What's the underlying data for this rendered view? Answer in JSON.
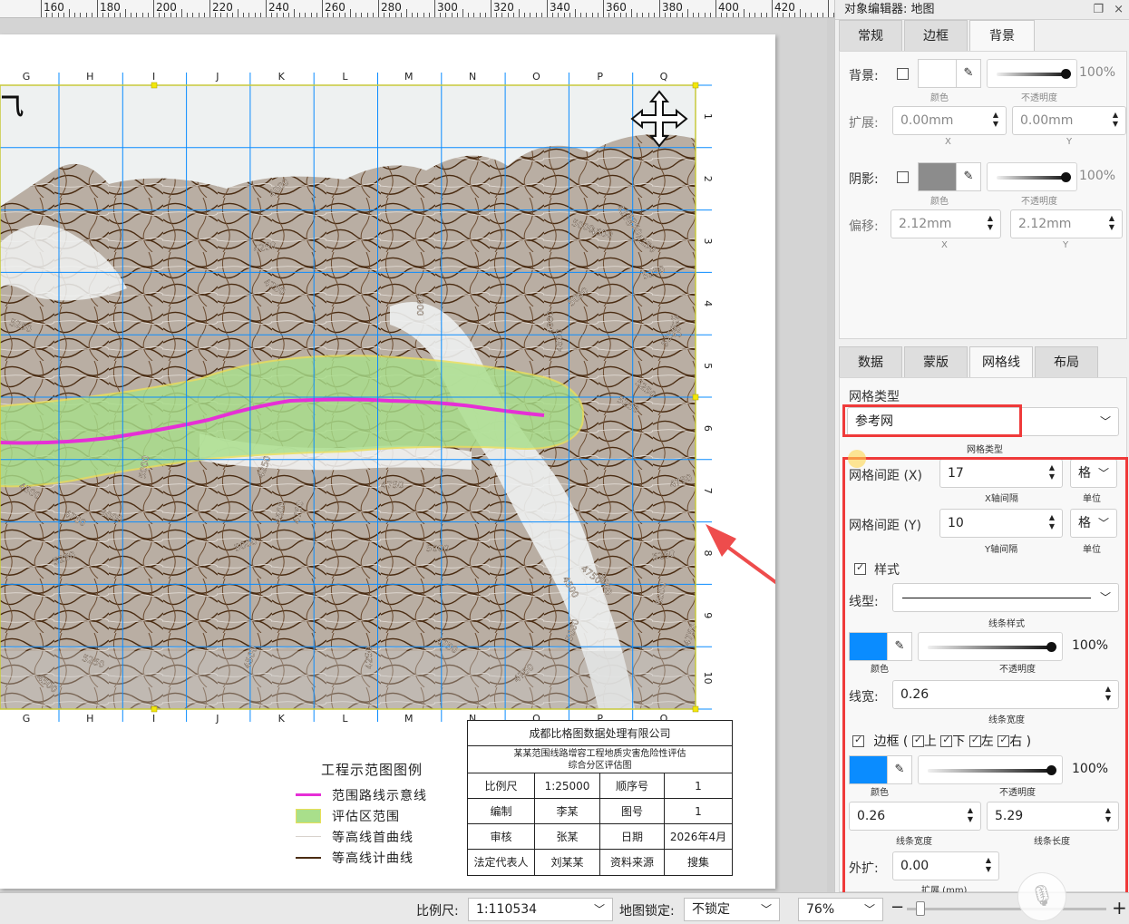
{
  "ruler": {
    "labels": [
      "160",
      "180",
      "200",
      "220",
      "240",
      "260",
      "280",
      "300",
      "320",
      "340",
      "360",
      "380",
      "400",
      "420"
    ]
  },
  "map": {
    "columns": [
      "G",
      "H",
      "I",
      "J",
      "K",
      "L",
      "M",
      "N",
      "O",
      "P",
      "Q"
    ],
    "rows": [
      "1",
      "2",
      "3",
      "4",
      "5",
      "6",
      "7",
      "8",
      "9",
      "10"
    ],
    "corner_text": "⺄",
    "contour_labels": [
      "4000",
      "4250",
      "4750",
      "5000",
      "4500",
      "5250",
      "4000",
      "4750",
      "5000",
      "5250",
      "4500",
      "4250",
      "4750",
      "5000",
      "5250",
      "5000",
      "4750",
      "4500",
      "5000",
      "5250",
      "5500",
      "4250",
      "4500",
      "5000",
      "5250",
      "4000",
      "4500",
      "4250",
      "5000",
      "4750",
      "4750",
      "5250",
      "4500",
      "5000",
      "5250",
      "5250",
      "4750",
      "5000",
      "4750",
      "4500",
      "4250",
      "4750",
      "5250"
    ],
    "contour_labels_count_note": ""
  },
  "legend": {
    "title": "工程示范图图例",
    "items": [
      {
        "label": "范围路线示意线",
        "symbol": "magenta-line",
        "color": "#e62fd6"
      },
      {
        "label": "评估区范围",
        "symbol": "green-fill",
        "color": "#a9df8b"
      },
      {
        "label": "等高线首曲线",
        "symbol": "thin-line",
        "color": "#cfc8c0"
      },
      {
        "label": "等高线计曲线",
        "symbol": "brown-line",
        "color": "#4a2c12"
      }
    ]
  },
  "titleblock": {
    "company": "成都比格图数据处理有限公司",
    "project_line1": "某某范围线路增容工程地质灾害危险性评估",
    "project_line2": "综合分区评估图",
    "rows": [
      [
        "比例尺",
        "1:25000",
        "顺序号",
        "1"
      ],
      [
        "编制",
        "李某",
        "图号",
        "1"
      ],
      [
        "审核",
        "张某",
        "日期",
        "2026年4月"
      ],
      [
        "法定代表人",
        "刘某某",
        "资料来源",
        "搜集"
      ]
    ]
  },
  "panel": {
    "title": "对象编辑器: 地图",
    "top_tabs": [
      "常规",
      "边框",
      "背景"
    ],
    "active_top_tab": "背景",
    "background": {
      "bg_label": "背景:",
      "bg_color_caption": "颜色",
      "bg_opacity": "100%",
      "opacity_caption": "不透明度",
      "expand_label": "扩展:",
      "expand_x": "0.00mm",
      "expand_y": "0.00mm",
      "x_caption": "X",
      "y_caption": "Y",
      "shadow_label": "阴影:",
      "shadow_color_caption": "颜色",
      "shadow_opacity": "100%",
      "offset_label": "偏移:",
      "offset_x": "2.12mm",
      "offset_y": "2.12mm",
      "shadow_color": "#8c8c8c"
    },
    "bottom_tabs": [
      "数据",
      "蒙版",
      "网格线",
      "布局"
    ],
    "active_bottom_tab": "网格线",
    "grid": {
      "type_label": "网格类型",
      "type_value": "参考网",
      "type_caption": "网格类型",
      "x_label": "网格间距 (X)",
      "x_value": "17",
      "x_caption": "X轴间隔",
      "x_unit": "格",
      "unit_caption": "单位",
      "y_label": "网格间距 (Y)",
      "y_value": "10",
      "y_caption": "Y轴间隔",
      "y_unit": "格",
      "style_label": "样式",
      "linetype_label": "线型:",
      "linetype_caption": "线条样式",
      "color_caption": "颜色",
      "line_color": "#0a8cff",
      "opacity": "100%",
      "opacity_caption": "不透明度",
      "width_label": "线宽:",
      "width_value": "0.26",
      "width_caption": "线条宽度",
      "border_label": "边框 (",
      "border_top": "上",
      "border_bottom": "下",
      "border_left": "左",
      "border_right": "右",
      "border_close": ")",
      "border_color": "#0a8cff",
      "border_opacity": "100%",
      "border_width": "0.26",
      "border_width_caption": "线条宽度",
      "border_length": "5.29",
      "border_length_caption": "线条长度",
      "outer_label": "外扩:",
      "outer_value": "0.00",
      "outer_caption": "扩展 (mm)"
    }
  },
  "status": {
    "scale_label": "比例尺:",
    "scale_value": "1:110534",
    "lock_label": "地图锁定:",
    "lock_value": "不锁定",
    "zoom_value": "76%",
    "minus": "−",
    "plus": "+"
  }
}
